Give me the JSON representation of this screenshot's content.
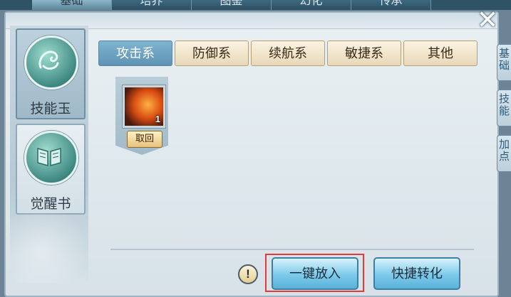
{
  "top_tabs": [
    "基础",
    "培养",
    "图鉴",
    "幻化",
    "传承"
  ],
  "categories": [
    {
      "label": "技能玉",
      "icon": "dragon-emblem-icon",
      "active": true
    },
    {
      "label": "觉醒书",
      "icon": "book-icon",
      "active": false
    }
  ],
  "tabs": [
    {
      "label": "攻击系",
      "active": true
    },
    {
      "label": "防御系",
      "active": false
    },
    {
      "label": "续航系",
      "active": false
    },
    {
      "label": "敏捷系",
      "active": false
    },
    {
      "label": "其他",
      "active": false
    }
  ],
  "item": {
    "icon": "fire-beast-skill-icon",
    "count": "1",
    "retrieve_label": "取回"
  },
  "buttons": {
    "info": "!",
    "put_all": "一键放入",
    "quick_convert": "快捷转化"
  },
  "side_tabs": [
    "基础",
    "技能",
    "加点"
  ],
  "colors": {
    "active_tab": "#6fa3c4",
    "highlight": "#e53a3a",
    "button_blue": "#7cc9ea"
  }
}
